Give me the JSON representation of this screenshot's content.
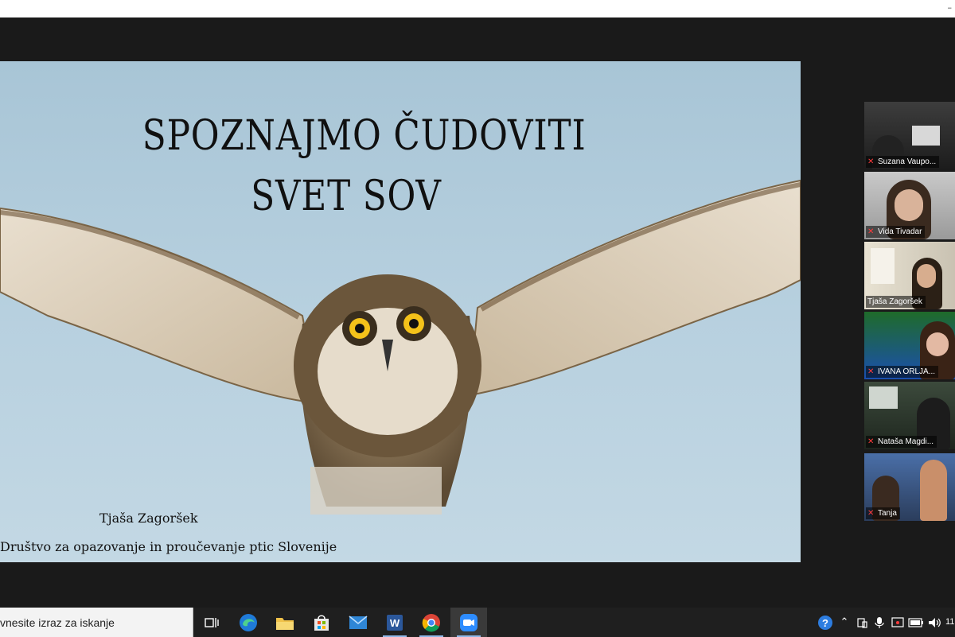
{
  "window": {
    "top_right_glyph": "–"
  },
  "slide": {
    "title_line1": "SPOZNAJMO ČUDOVITI",
    "title_line2": "SVET SOV",
    "author": "Tjaša Zagoršek",
    "organization": "Društvo za opazovanje in proučevanje ptic Slovenije"
  },
  "participants": [
    {
      "name": "Suzana Vaupo...",
      "muted": true,
      "active": false
    },
    {
      "name": "Vida Tivadar",
      "muted": true,
      "active": false
    },
    {
      "name": "Tjaša Zagoršek",
      "muted": false,
      "active": true
    },
    {
      "name": "IVANA ORLJA...",
      "muted": true,
      "active": false
    },
    {
      "name": "Nataša Magdi...",
      "muted": true,
      "active": false
    },
    {
      "name": "Tanja",
      "muted": true,
      "active": false
    }
  ],
  "taskbar": {
    "search_placeholder": "vnesite izraz za iskanje",
    "apps": [
      "task-view",
      "edge",
      "file-explorer",
      "store",
      "mail",
      "word",
      "chrome",
      "zoom"
    ],
    "clock": "11"
  },
  "colors": {
    "active_speaker": "#e9e34a",
    "muted_mic": "#ff3b3b",
    "taskbar": "#1f1f1f"
  }
}
